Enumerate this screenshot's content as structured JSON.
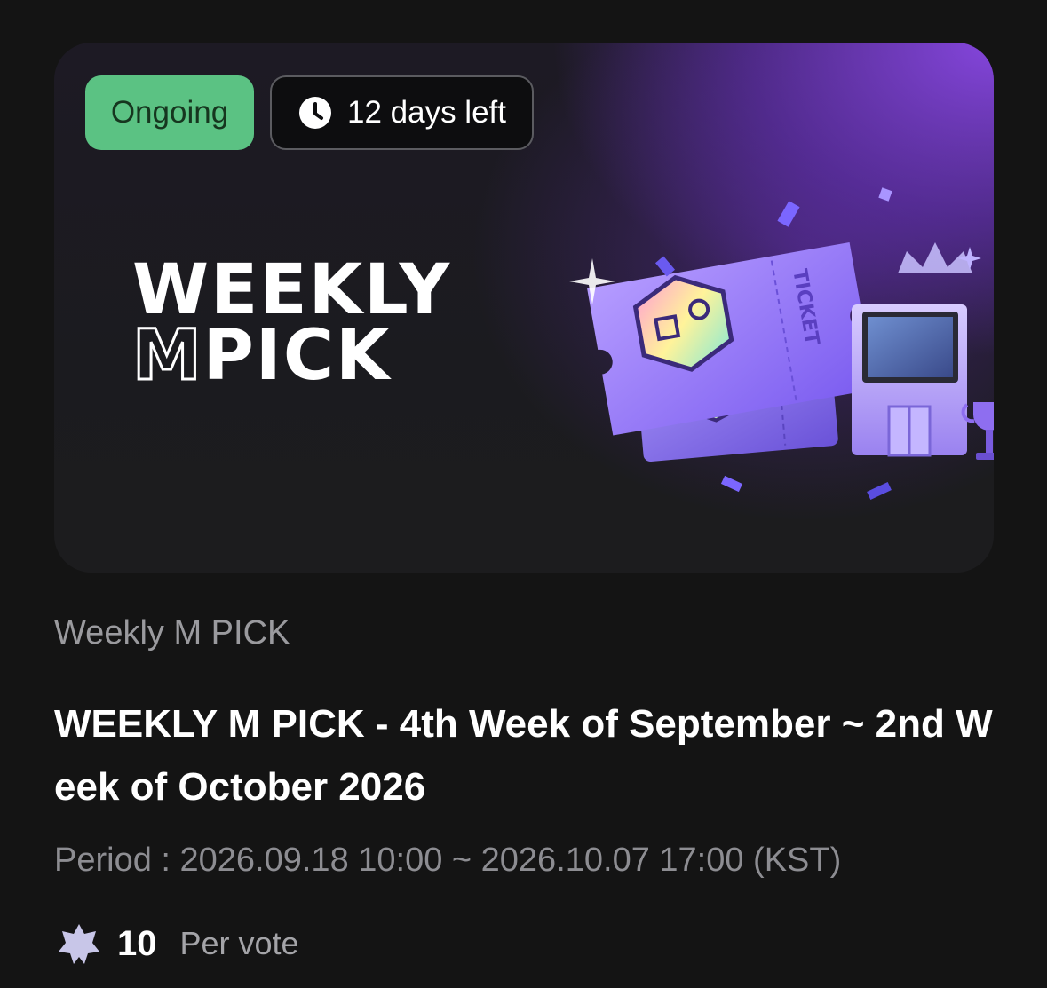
{
  "banner": {
    "status_label": "Ongoing",
    "time_left_label": "12 days left",
    "logo_line1": "WEEKLY",
    "logo_line2_m": "M",
    "logo_line2_rest": "PICK",
    "ticket_text": "TICKET",
    "status_color": "#5bc283",
    "accent_color": "#8a48e6"
  },
  "event": {
    "category": "Weekly M PICK",
    "title": "WEEKLY M PICK - 4th Week of September ~ 2nd Week of October 2026",
    "period": "Period : 2026.09.18 10:00 ~ 2026.10.07 17:00 (KST)",
    "vote_cost": "10",
    "vote_unit": "Per vote",
    "vote_icon": "star-icon"
  }
}
